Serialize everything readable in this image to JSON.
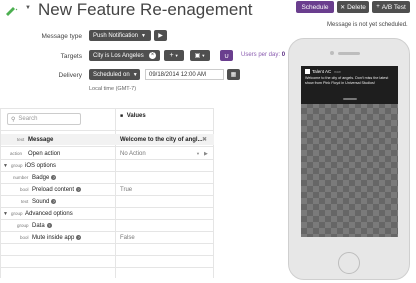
{
  "header": {
    "title": "New Feature Re-enagement",
    "buttons": {
      "schedule": "Schedule",
      "delete": "Delete",
      "ab_test": "A/B Test"
    },
    "status_message": "Message is not yet scheduled."
  },
  "form": {
    "message_type": {
      "label": "Message type",
      "value": "Push Notification"
    },
    "targets": {
      "label": "Targets",
      "value": "City is Los Angeles",
      "users_per_day_label": "Users per day:",
      "users_per_day_value": "0"
    },
    "delivery": {
      "label": "Delivery",
      "value": "Scheduled on",
      "date": "09/18/2014 12:00 AM",
      "local_time": "Local time (GMT-7)"
    }
  },
  "table": {
    "search_placeholder": "Search",
    "values_header": "Values",
    "rows": [
      {
        "type": "text",
        "name": "Message",
        "value": "Welcome to the city of angl..."
      },
      {
        "type": "action",
        "name": "Open action",
        "value": "No Action"
      },
      {
        "type": "group",
        "name": "iOS options",
        "value": ""
      },
      {
        "type": "number",
        "name": "Badge",
        "value": ""
      },
      {
        "type": "bool",
        "name": "Preload content",
        "value": "True"
      },
      {
        "type": "text",
        "name": "Sound",
        "value": ""
      },
      {
        "type": "group",
        "name": "Advanced options",
        "value": ""
      },
      {
        "type": "group",
        "name": "Data",
        "value": ""
      },
      {
        "type": "bool",
        "name": "Mute inside app",
        "value": "False"
      }
    ]
  },
  "phone": {
    "notification": {
      "app_name": "Talent AC",
      "time": "now",
      "body": "Welcome to the city of angels. Don't miss the latest show from Pink Floyd in Universal Studios!"
    }
  },
  "colors": {
    "accent": "#6a3e8e",
    "dark_button": "#4f4f4f",
    "link_purple": "#8a5cb0"
  }
}
